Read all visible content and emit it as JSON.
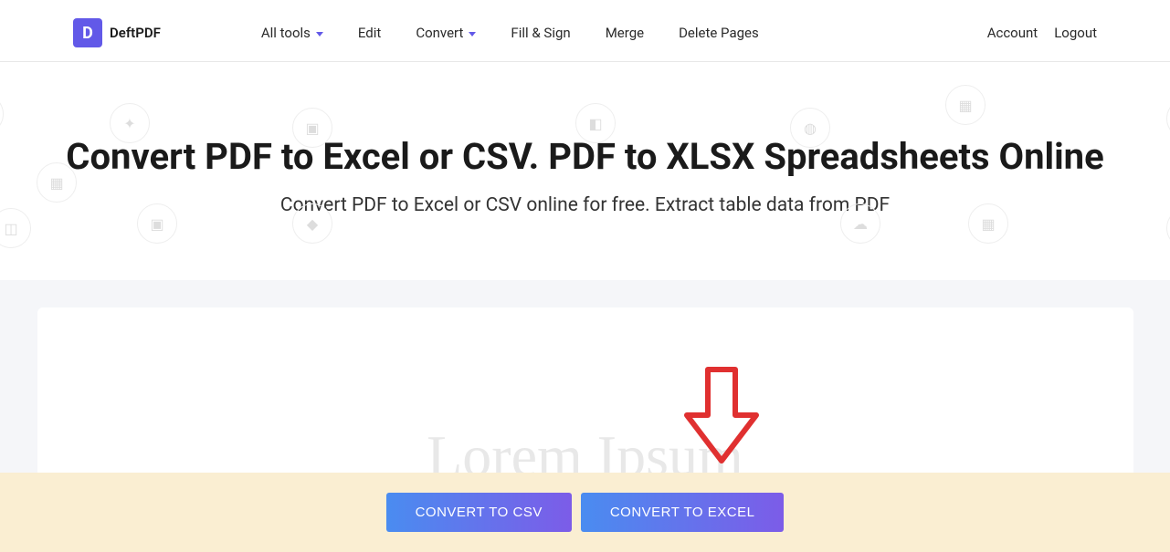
{
  "header": {
    "logo_letter": "D",
    "logo_text": "DeftPDF",
    "nav": {
      "all_tools": "All tools",
      "edit": "Edit",
      "convert": "Convert",
      "fill_sign": "Fill & Sign",
      "merge": "Merge",
      "delete_pages": "Delete Pages"
    },
    "account": "Account",
    "logout": "Logout"
  },
  "hero": {
    "title": "Convert PDF to Excel or CSV. PDF to XLSX Spreadsheets Online",
    "subtitle": "Convert PDF to Excel or CSV online for free. Extract table data from PDF"
  },
  "watermark": "Lorem Ipsum",
  "actions": {
    "convert_csv": "CONVERT TO CSV",
    "convert_excel": "CONVERT TO EXCEL"
  }
}
